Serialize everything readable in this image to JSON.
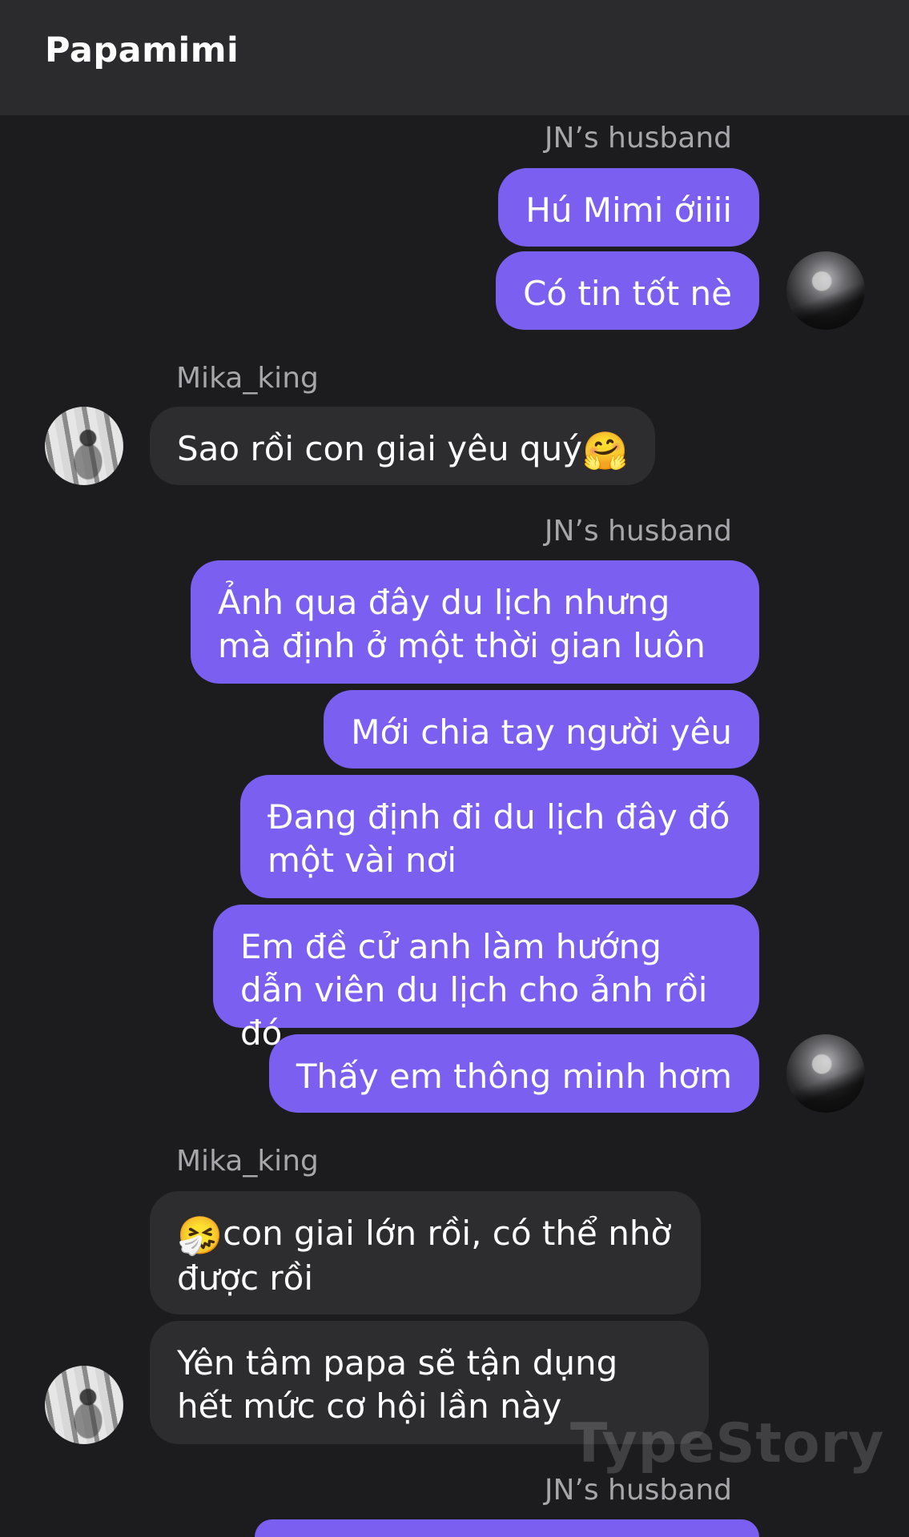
{
  "header": {
    "title": "Papamimi"
  },
  "senders": {
    "husband": "JN’s husband",
    "mika": "Mika_king"
  },
  "messages": {
    "m1": "Hú Mimi ớiiii",
    "m2": "Có tin tốt nè",
    "m3": "Sao rồi con giai yêu quý",
    "m3_emoji": "🤗",
    "m4": "Ảnh qua đây du lịch nhưng mà định ở một thời gian luôn",
    "m5": "Mới chia tay người yêu",
    "m6": "Đang định đi du lịch đây đó một vài nơi",
    "m7": "Em đề cử anh làm hướng dẫn viên du lịch cho ảnh rồi đó",
    "m8": "Thấy em thông minh hơm",
    "m9_emoji": "🤧",
    "m9": "con giai lớn rồi, có thể nhờ được rồi",
    "m10": "Yên tâm papa sẽ tận dụng hết mức cơ hội lần này"
  },
  "watermark": "TypeStory",
  "colors": {
    "background": "#1c1c1e",
    "header": "#2b2b2d",
    "outgoing_bubble": "#7a5ff0",
    "incoming_bubble": "#2d2d30",
    "sender_label": "#a6a6ab"
  }
}
